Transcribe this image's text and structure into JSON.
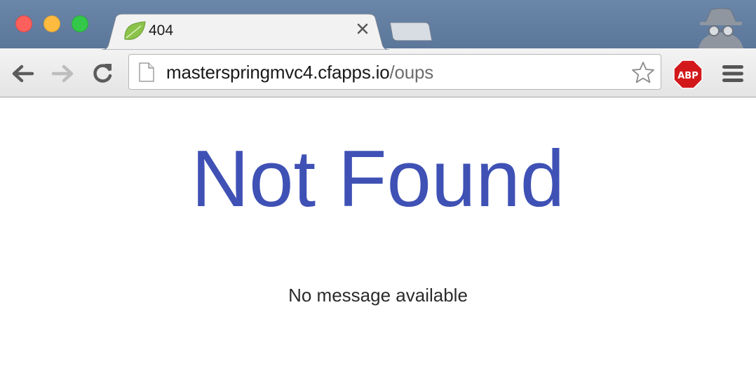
{
  "browser": {
    "tab": {
      "title": "404",
      "favicon": "spring-leaf-icon"
    },
    "address_bar": {
      "host": "masterspringmvc4.cfapps.io",
      "path": "/oups"
    },
    "extensions": {
      "adblock_label": "ABP"
    },
    "icons": {
      "back": "arrow-left-icon",
      "forward": "arrow-right-icon",
      "reload": "reload-icon",
      "bookmark": "star-icon",
      "menu": "hamburger-icon",
      "incognito": "incognito-icon"
    },
    "colors": {
      "tabstrip": "#5f7a9d",
      "adblock_red": "#d3181b",
      "leaf_green": "#8bc34a"
    }
  },
  "page": {
    "title": "Not Found",
    "message": "No message available",
    "title_color": "#3f51b5"
  }
}
